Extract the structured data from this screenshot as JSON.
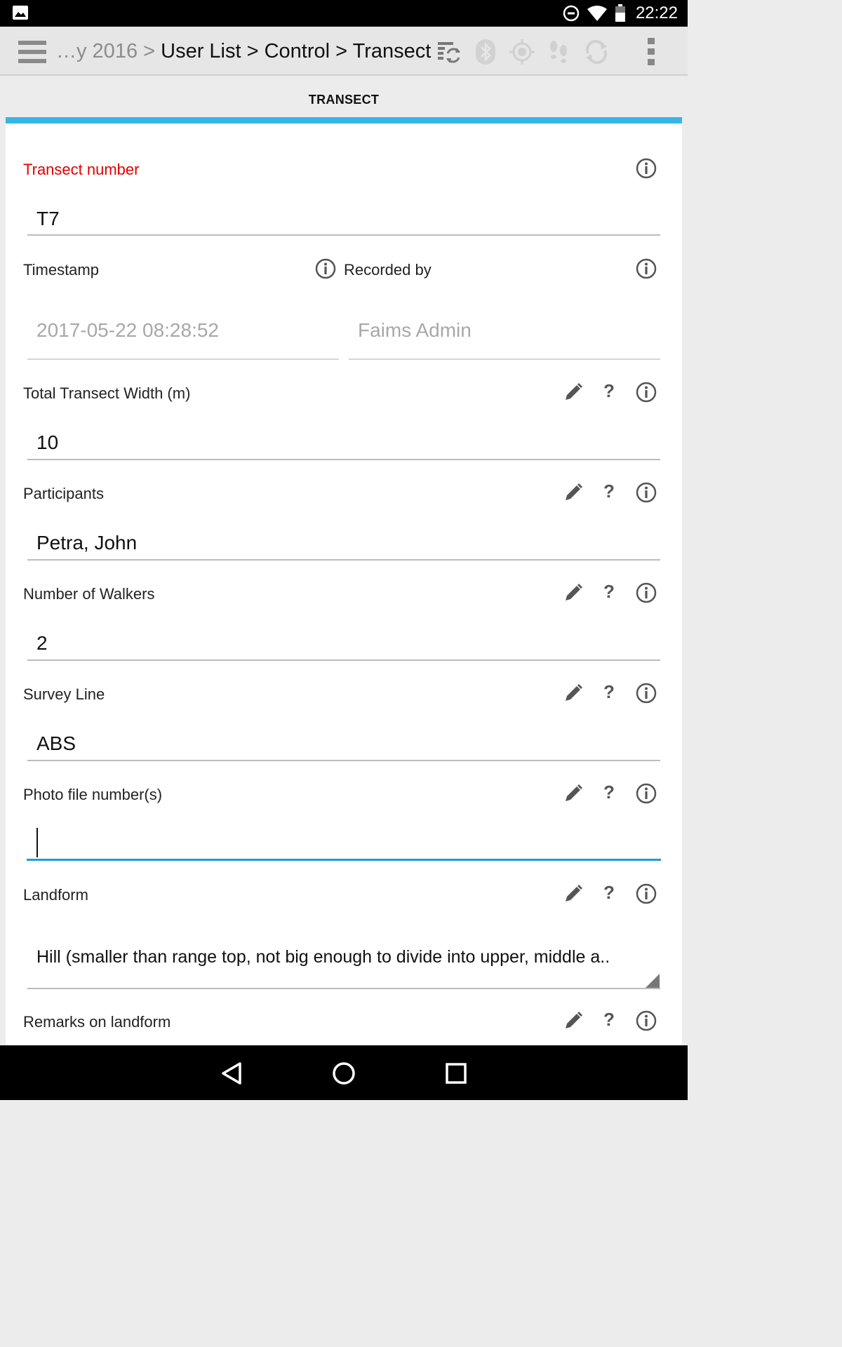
{
  "status_bar": {
    "time": "22:22",
    "icons": [
      "gallery-icon",
      "do-not-disturb-icon",
      "wifi-icon",
      "battery-icon"
    ]
  },
  "action_bar": {
    "breadcrumb_faded": "…y 2016 > ",
    "breadcrumb_path": "User List > Control > Transect",
    "icons": [
      "sync-list-icon",
      "bluetooth-icon",
      "gps-icon",
      "tracklog-icon",
      "sync-icon",
      "overflow-menu-icon"
    ]
  },
  "tab": {
    "label": "TRANSECT"
  },
  "form": {
    "transect_number": {
      "label": "Transect number",
      "value": "T7"
    },
    "timestamp": {
      "label": "Timestamp",
      "value": "2017-05-22 08:28:52"
    },
    "recorded_by": {
      "label": "Recorded by",
      "value": "Faims Admin"
    },
    "width": {
      "label": "Total Transect Width (m)",
      "value": "10"
    },
    "participants": {
      "label": "Participants",
      "value": "Petra, John"
    },
    "walkers": {
      "label": "Number of Walkers",
      "value": "2"
    },
    "survey_line": {
      "label": "Survey Line",
      "value": "ABS"
    },
    "photo": {
      "label": "Photo file number(s)",
      "value": ""
    },
    "landform": {
      "label": "Landform",
      "value": "Hill (smaller than range top, not big enough to divide into upper, middle a.."
    },
    "remarks": {
      "label": "Remarks on landform"
    },
    "help_glyph": "?"
  },
  "colors": {
    "accent": "#33b5e5",
    "required": "#e00000",
    "focus": "#1e9fd1"
  }
}
